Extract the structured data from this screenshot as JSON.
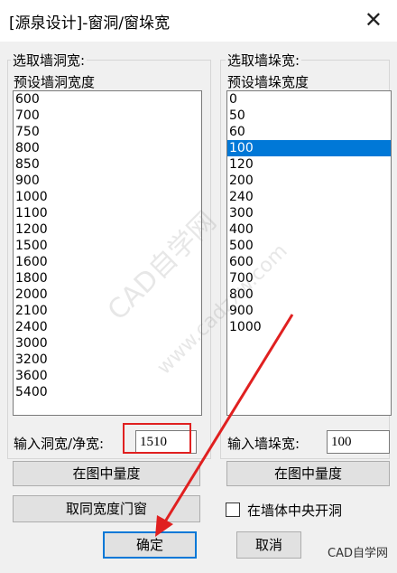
{
  "window": {
    "title": "[源泉设计]-窗洞/窗垛宽",
    "close_glyph": "✕"
  },
  "left": {
    "group_label": "选取墙洞宽:",
    "list_header": "预设墙洞宽度",
    "items": [
      "600",
      "700",
      "750",
      "800",
      "850",
      "900",
      "1000",
      "1100",
      "1200",
      "1500",
      "1600",
      "1800",
      "2000",
      "2100",
      "2400",
      "3000",
      "3200",
      "3600",
      "5400"
    ],
    "input_label": "输入洞宽/净宽:",
    "input_value": "1510",
    "measure_button": "在图中量度",
    "same_width_button": "取同宽度门窗"
  },
  "right": {
    "group_label": "选取墙垛宽:",
    "list_header": "预设墙垛宽度",
    "items": [
      "0",
      "50",
      "60",
      "100",
      "120",
      "200",
      "240",
      "300",
      "400",
      "500",
      "600",
      "700",
      "800",
      "900",
      "1000"
    ],
    "selected_index": 3,
    "input_label": "输入墙垛宽:",
    "input_value": "100",
    "measure_button": "在图中量度",
    "center_checkbox_label": "在墙体中央开洞",
    "center_checkbox_checked": false
  },
  "footer": {
    "ok_button": "确定",
    "cancel_button": "取消"
  },
  "watermark": {
    "text": "CAD自学网",
    "url_text": "www.cadzxw.com",
    "logo_text": "CAD自学网"
  },
  "colors": {
    "selection": "#0078d7",
    "annotation_red": "#e02020",
    "default_button_border": "#0078d7"
  }
}
